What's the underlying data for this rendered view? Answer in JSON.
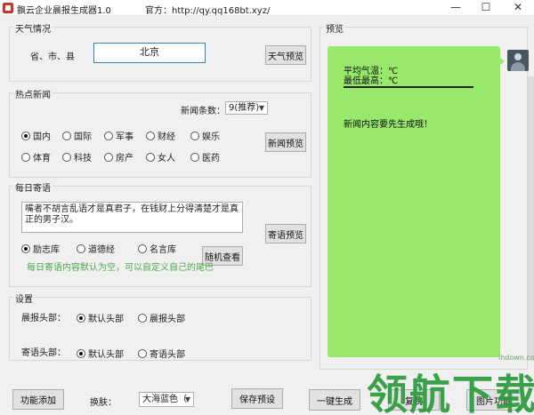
{
  "window": {
    "title": "飘云企业晨报生成器1.0",
    "site": "官方：http://qy.qq168bt.xyz/",
    "min": "—",
    "max": "☐",
    "close": "✕"
  },
  "weather": {
    "group_title": "天气情况",
    "region_label": "省、市、县",
    "city_value": "北京",
    "preview_button": "天气预览"
  },
  "news": {
    "group_title": "热点新闻",
    "count_label": "新闻条数：",
    "count_value": "9(推荐)",
    "categories": [
      "国内",
      "国际",
      "军事",
      "财经",
      "娱乐",
      "体育",
      "科技",
      "房产",
      "女人",
      "医药"
    ],
    "selected": "国内",
    "preview_button": "新闻预览"
  },
  "quote": {
    "group_title": "每日寄语",
    "text": "嘴者不胡言乱语才是真君子，在钱财上分得清楚才是真正的男子汉。",
    "sources": [
      "励志库",
      "道德经",
      "名言库"
    ],
    "selected": "励志库",
    "random_button": "随机查看",
    "preview_button": "寄语预览",
    "hint": "每日寄语内容默认为空，可以自定义自己的尾巴"
  },
  "settings": {
    "group_title": "设置",
    "morning_header_label": "晨报头部：",
    "quote_header_label": "寄语头部：",
    "default_header": "默认头部",
    "custom_header": "晨报头部",
    "custom_quote_header": "寄语头部"
  },
  "bottom": {
    "add_button": "功能添加",
    "skin_label": "换肤：",
    "skin_value": "大海蓝色（",
    "save_button": "保存预设",
    "generate_button": "一键生成",
    "copy_button": "复制",
    "image_button": "图片功能"
  },
  "preview": {
    "group_title": "预览",
    "avg_temp": "平均气温：℃",
    "min_max": "最低最高：℃",
    "news_placeholder": "新闻内容要先生成哦！"
  },
  "watermark": {
    "text": "领航下载",
    "site": "ihdown.com"
  },
  "colors": {
    "preview_bubble": "#98e86c",
    "hint_text": "#4aa84a",
    "watermark": "#2b9a3c"
  }
}
